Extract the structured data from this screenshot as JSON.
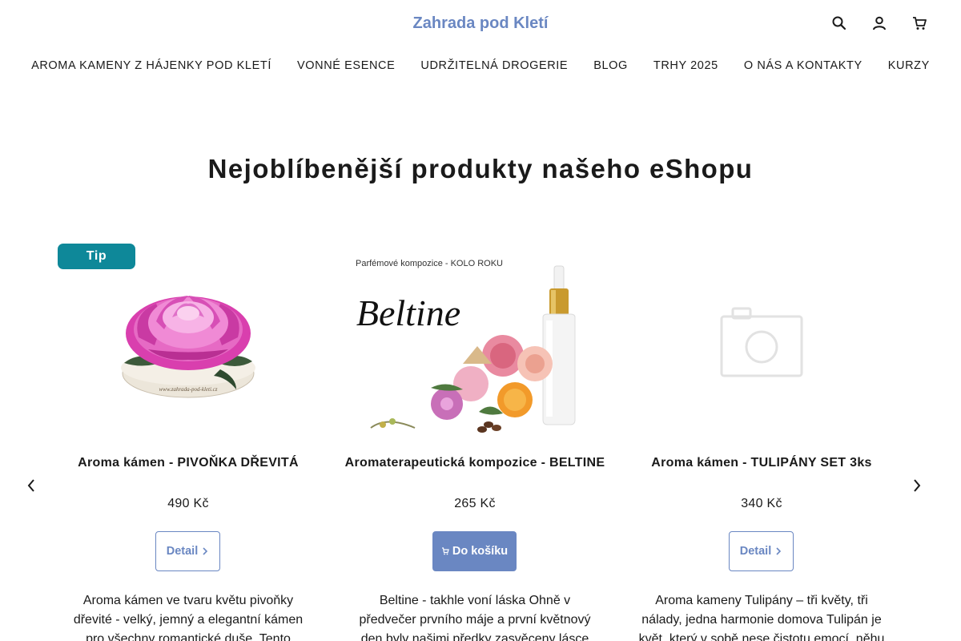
{
  "header": {
    "site_title": "Zahrada pod Kletí",
    "icons": [
      "search-icon",
      "user-icon",
      "cart-icon"
    ]
  },
  "nav": {
    "items": [
      "AROMA KAMENY Z HÁJENKY POD KLETÍ",
      "VONNÉ ESENCE",
      "UDRŽITELNÁ DROGERIE",
      "BLOG",
      "TRHY 2025",
      "O NÁS A KONTAKTY",
      "KURZY"
    ]
  },
  "section": {
    "title": "Nejoblíbenější produkty našeho eShopu"
  },
  "products": [
    {
      "badge": "Tip",
      "title": "Aroma kámen - PIVOŇKA DŘEVITÁ",
      "price": "490 Kč",
      "button": "Detail",
      "description": "Aroma kámen ve tvaru květu pivoňky dřevité - velký, jemný a elegantní kámen pro všechny romantické duše. Tento",
      "image_text": "www.zahrada-pod-kleti.cz"
    },
    {
      "title": "Aromaterapeutická kompozice - BELTINE",
      "price": "265 Kč",
      "button": "Do košíku",
      "description": "Beltine - takhle voní láska Ohně v předvečer prvního máje a první květnový den byly našimi předky zasvěceny lásce",
      "image_caption": "Parfémové kompozice - KOLO ROKU",
      "image_script": "Beltine"
    },
    {
      "title": "Aroma kámen - TULIPÁNY SET 3ks",
      "price": "340 Kč",
      "button": "Detail",
      "description": "Aroma kameny Tulipány – tři květy, tři nálady, jedna harmonie domova Tulipán je květ, který v sobě nese čistotu emocí, něhu"
    }
  ],
  "colors": {
    "accent": "#6a87c2",
    "badge": "#0e8899",
    "text": "#1a1a1a"
  }
}
